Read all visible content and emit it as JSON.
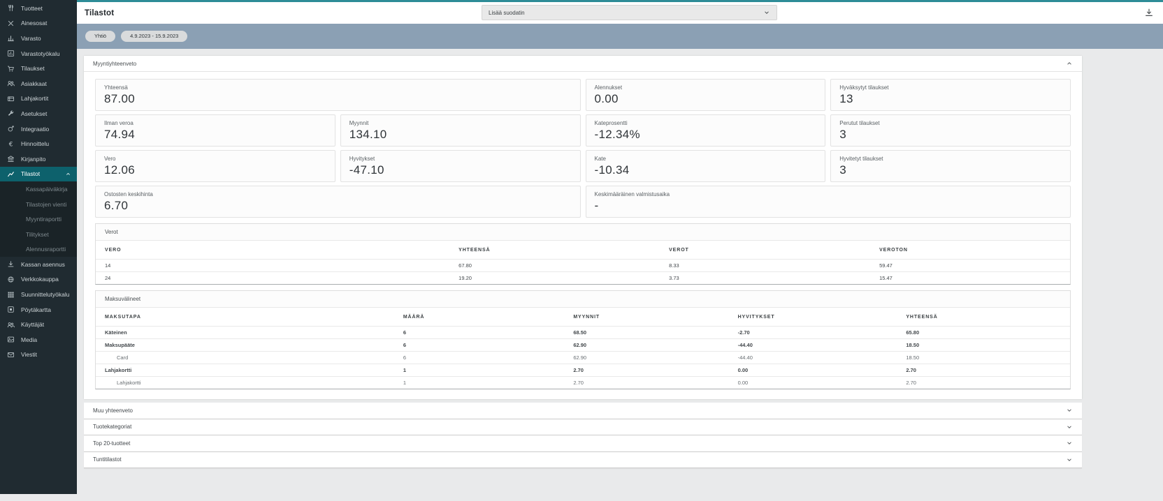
{
  "colors": {
    "accent_teal": "#0d616c",
    "topline_teal": "#2e8c97",
    "filterbar_blue": "#8ba0b4",
    "sidebar_dark": "#202b31"
  },
  "sidebar": {
    "items": [
      {
        "label": "Tuotteet",
        "icon": "utensils-icon"
      },
      {
        "label": "Ainesosat",
        "icon": "crossed-utensils-icon"
      },
      {
        "label": "Varasto",
        "icon": "bar-chart-icon"
      },
      {
        "label": "Varastotyökalu",
        "icon": "chart-box-icon"
      },
      {
        "label": "Tilaukset",
        "icon": "cart-icon"
      },
      {
        "label": "Asiakkaat",
        "icon": "users-icon"
      },
      {
        "label": "Lahjakortit",
        "icon": "gift-card-icon"
      },
      {
        "label": "Asetukset",
        "icon": "wrench-icon"
      },
      {
        "label": "Integraatio",
        "icon": "integration-icon"
      },
      {
        "label": "Hinnoittelu",
        "icon": "euro-icon"
      },
      {
        "label": "Kirjanpito",
        "icon": "bank-icon"
      },
      {
        "label": "Tilastot",
        "icon": "line-chart-icon",
        "active": true,
        "expanded": true
      }
    ],
    "submenu_items": [
      {
        "label": "Kassapäiväkirja"
      },
      {
        "label": "Tilastojen vienti"
      },
      {
        "label": "Myyntiraportti"
      },
      {
        "label": "Tilitykset"
      },
      {
        "label": "Alennusraportti"
      }
    ],
    "bottom_items": [
      {
        "label": "Kassan asennus",
        "icon": "download-icon"
      },
      {
        "label": "Verkkokauppa",
        "icon": "globe-icon"
      },
      {
        "label": "Suunnittelutyökalu",
        "icon": "grid-icon"
      },
      {
        "label": "Pöytäkartta",
        "icon": "table-map-icon"
      },
      {
        "label": "Käyttäjät",
        "icon": "users-icon"
      },
      {
        "label": "Media",
        "icon": "image-icon"
      },
      {
        "label": "Viestit",
        "icon": "mail-icon"
      }
    ]
  },
  "topbar": {
    "title": "Tilastot",
    "filter_dropdown_label": "Lisää suodatin",
    "export_icon": "download-icon"
  },
  "filter_chips": [
    "Yhtiö",
    "4.9.2023 - 15.9.2023"
  ],
  "sales_summary": {
    "title": "Myyntiyhteenveto",
    "cards": [
      {
        "label": "Yhteensä",
        "value": "87.00"
      },
      {
        "label": "Alennukset",
        "value": "0.00"
      },
      {
        "label": "Hyväksytyt tilaukset",
        "value": "13"
      },
      {
        "label": "Ilman veroa",
        "value": "74.94"
      },
      {
        "label": "Myynnit",
        "value": "134.10"
      },
      {
        "label": "Kateprosentti",
        "value": "-12.34%"
      },
      {
        "label": "Perutut tilaukset",
        "value": "3"
      },
      {
        "label": "Vero",
        "value": "12.06"
      },
      {
        "label": "Hyvitykset",
        "value": "-47.10"
      },
      {
        "label": "Kate",
        "value": "-10.34"
      },
      {
        "label": "Hyvitetyt tilaukset",
        "value": "3"
      },
      {
        "label": "Ostosten keskihinta",
        "value": "6.70"
      },
      {
        "label": "Keskimääräinen valmistusaika",
        "value": "-"
      }
    ],
    "taxes": {
      "title": "Verot",
      "headers": [
        "VERO",
        "YHTEENSÄ",
        "VEROT",
        "VEROTON"
      ],
      "rows": [
        [
          "14",
          "67.80",
          "8.33",
          "59.47"
        ],
        [
          "24",
          "19.20",
          "3.73",
          "15.47"
        ]
      ]
    },
    "payment_methods": {
      "title": "Maksuvälineet",
      "headers": [
        "MAKSUTAPA",
        "MÄÄRÄ",
        "MYYNNIT",
        "HYVITYKSET",
        "YHTEENSÄ"
      ],
      "rows": [
        {
          "cells": [
            "Käteinen",
            "6",
            "68.50",
            "-2.70",
            "65.80"
          ],
          "indent": false
        },
        {
          "cells": [
            "Maksupääte",
            "6",
            "62.90",
            "-44.40",
            "18.50"
          ],
          "indent": false
        },
        {
          "cells": [
            "Card",
            "6",
            "62.90",
            "-44.40",
            "18.50"
          ],
          "indent": true
        },
        {
          "cells": [
            "Lahjakortti",
            "1",
            "2.70",
            "0.00",
            "2.70"
          ],
          "indent": false
        },
        {
          "cells": [
            "Lahjakortti",
            "1",
            "2.70",
            "0.00",
            "2.70"
          ],
          "indent": true
        }
      ]
    }
  },
  "collapsed_sections": [
    {
      "label": "Muu yhteenveto"
    },
    {
      "label": "Tuotekategoriat"
    },
    {
      "label": "Top 20-tuotteet"
    },
    {
      "label": "Tuntitilastot"
    }
  ]
}
